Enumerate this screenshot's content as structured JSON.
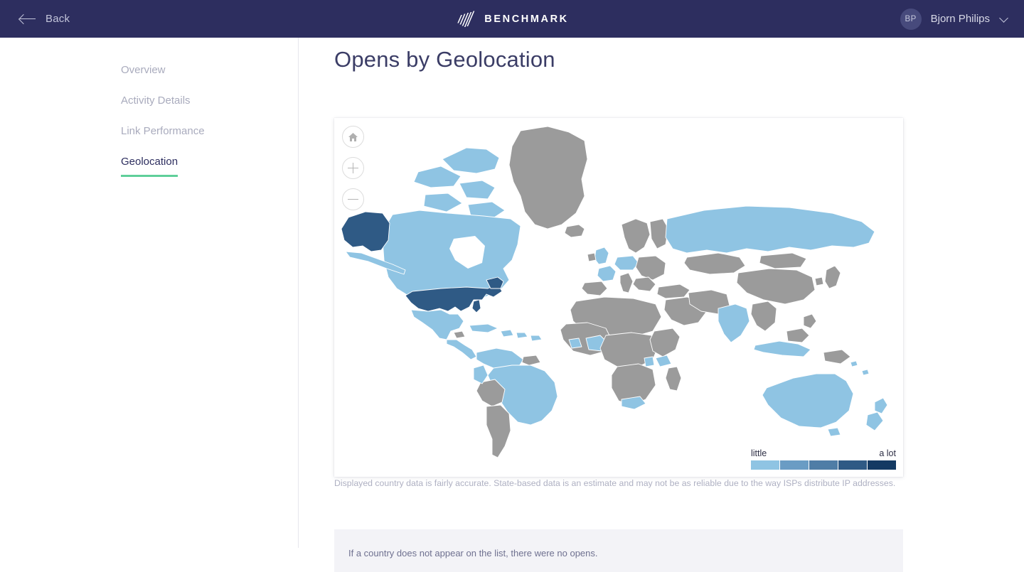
{
  "topbar": {
    "back_label": "Back",
    "back_icon": "arrow-left-icon",
    "brand_name": "BENCHMARK",
    "brand_logo_icon": "benchmark-slashes-logo",
    "user_initials": "BP",
    "user_name": "Bjorn Philips",
    "user_caret_icon": "chevron-down-icon",
    "background_color": "#2d2e5f"
  },
  "sidebar": {
    "items": [
      {
        "label": "Overview",
        "active": false
      },
      {
        "label": "Activity Details",
        "active": false
      },
      {
        "label": "Link Performance",
        "active": false
      },
      {
        "label": "Geolocation",
        "active": true
      }
    ],
    "active_underline_color": "#5fcf9a"
  },
  "main": {
    "page_title": "Opens by Geolocation",
    "footnote": "Displayed country data is fairly accurate. State-based data is an estimate and may not be as reliable due to the way ISPs distribute IP addresses.",
    "bottom_panel_text": "If a country does not appear on the list, there were no opens."
  },
  "map": {
    "controls": [
      {
        "name": "home",
        "icon": "home-icon"
      },
      {
        "name": "zoom-in",
        "icon": "plus-icon"
      },
      {
        "name": "zoom-out",
        "icon": "minus-icon"
      }
    ],
    "legend": {
      "low_label": "little",
      "high_label": "a lot",
      "colors": [
        "#8fc4e3",
        "#6a9cc4",
        "#4f7da6",
        "#2f5a85",
        "#143a63"
      ]
    },
    "no_data_color": "#9b9b9b",
    "ocean_color": "#ffffff",
    "country_values": [
      {
        "country": "United States",
        "level": 5
      },
      {
        "country": "Alaska (US)",
        "level": 4
      },
      {
        "country": "Canada",
        "level": 1
      },
      {
        "country": "Mexico",
        "level": 1
      },
      {
        "country": "Brazil",
        "level": 1
      },
      {
        "country": "Russia",
        "level": 1
      },
      {
        "country": "India",
        "level": 1
      },
      {
        "country": "Australia",
        "level": 1
      },
      {
        "country": "New Zealand",
        "level": 1
      },
      {
        "country": "United Kingdom",
        "level": 1
      },
      {
        "country": "Greenland",
        "level": 0
      },
      {
        "country": "Bolivia",
        "level": 0
      }
    ]
  }
}
